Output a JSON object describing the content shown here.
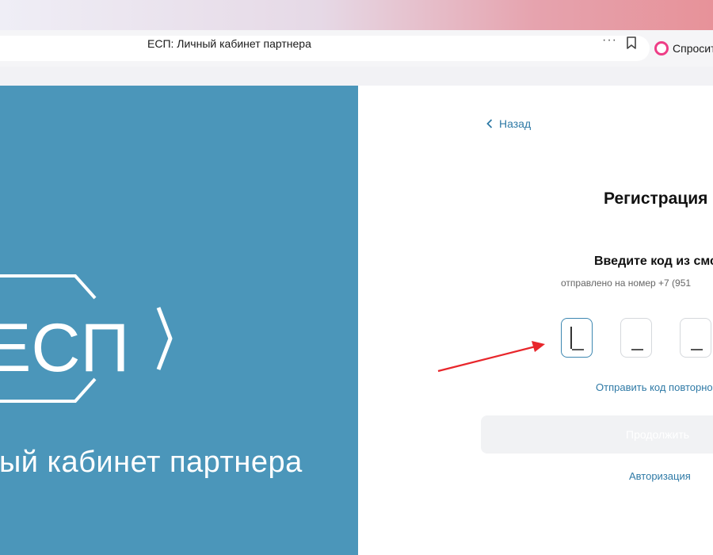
{
  "browser": {
    "page_title": "ЕСП: Личный кабинет партнера",
    "more_label": "···",
    "ask_label": "Спросить"
  },
  "brand": {
    "logo_text": "ЕСП",
    "cabinet_label": "Личный кабинет партнера"
  },
  "form": {
    "back_label": "Назад",
    "heading": "Регистрация",
    "subheading": "Введите код из смс",
    "sent_to": "отправлено на номер +7 (951",
    "resend_label": "Отправить код повторно",
    "continue_label": "Продолжить",
    "auth_label": "Авторизация",
    "code_digits": [
      "",
      "",
      "",
      ""
    ]
  },
  "colors": {
    "brand_blue": "#4b96ba",
    "link_blue": "#2f7aa6",
    "annotation_arrow": "#e8262b"
  }
}
